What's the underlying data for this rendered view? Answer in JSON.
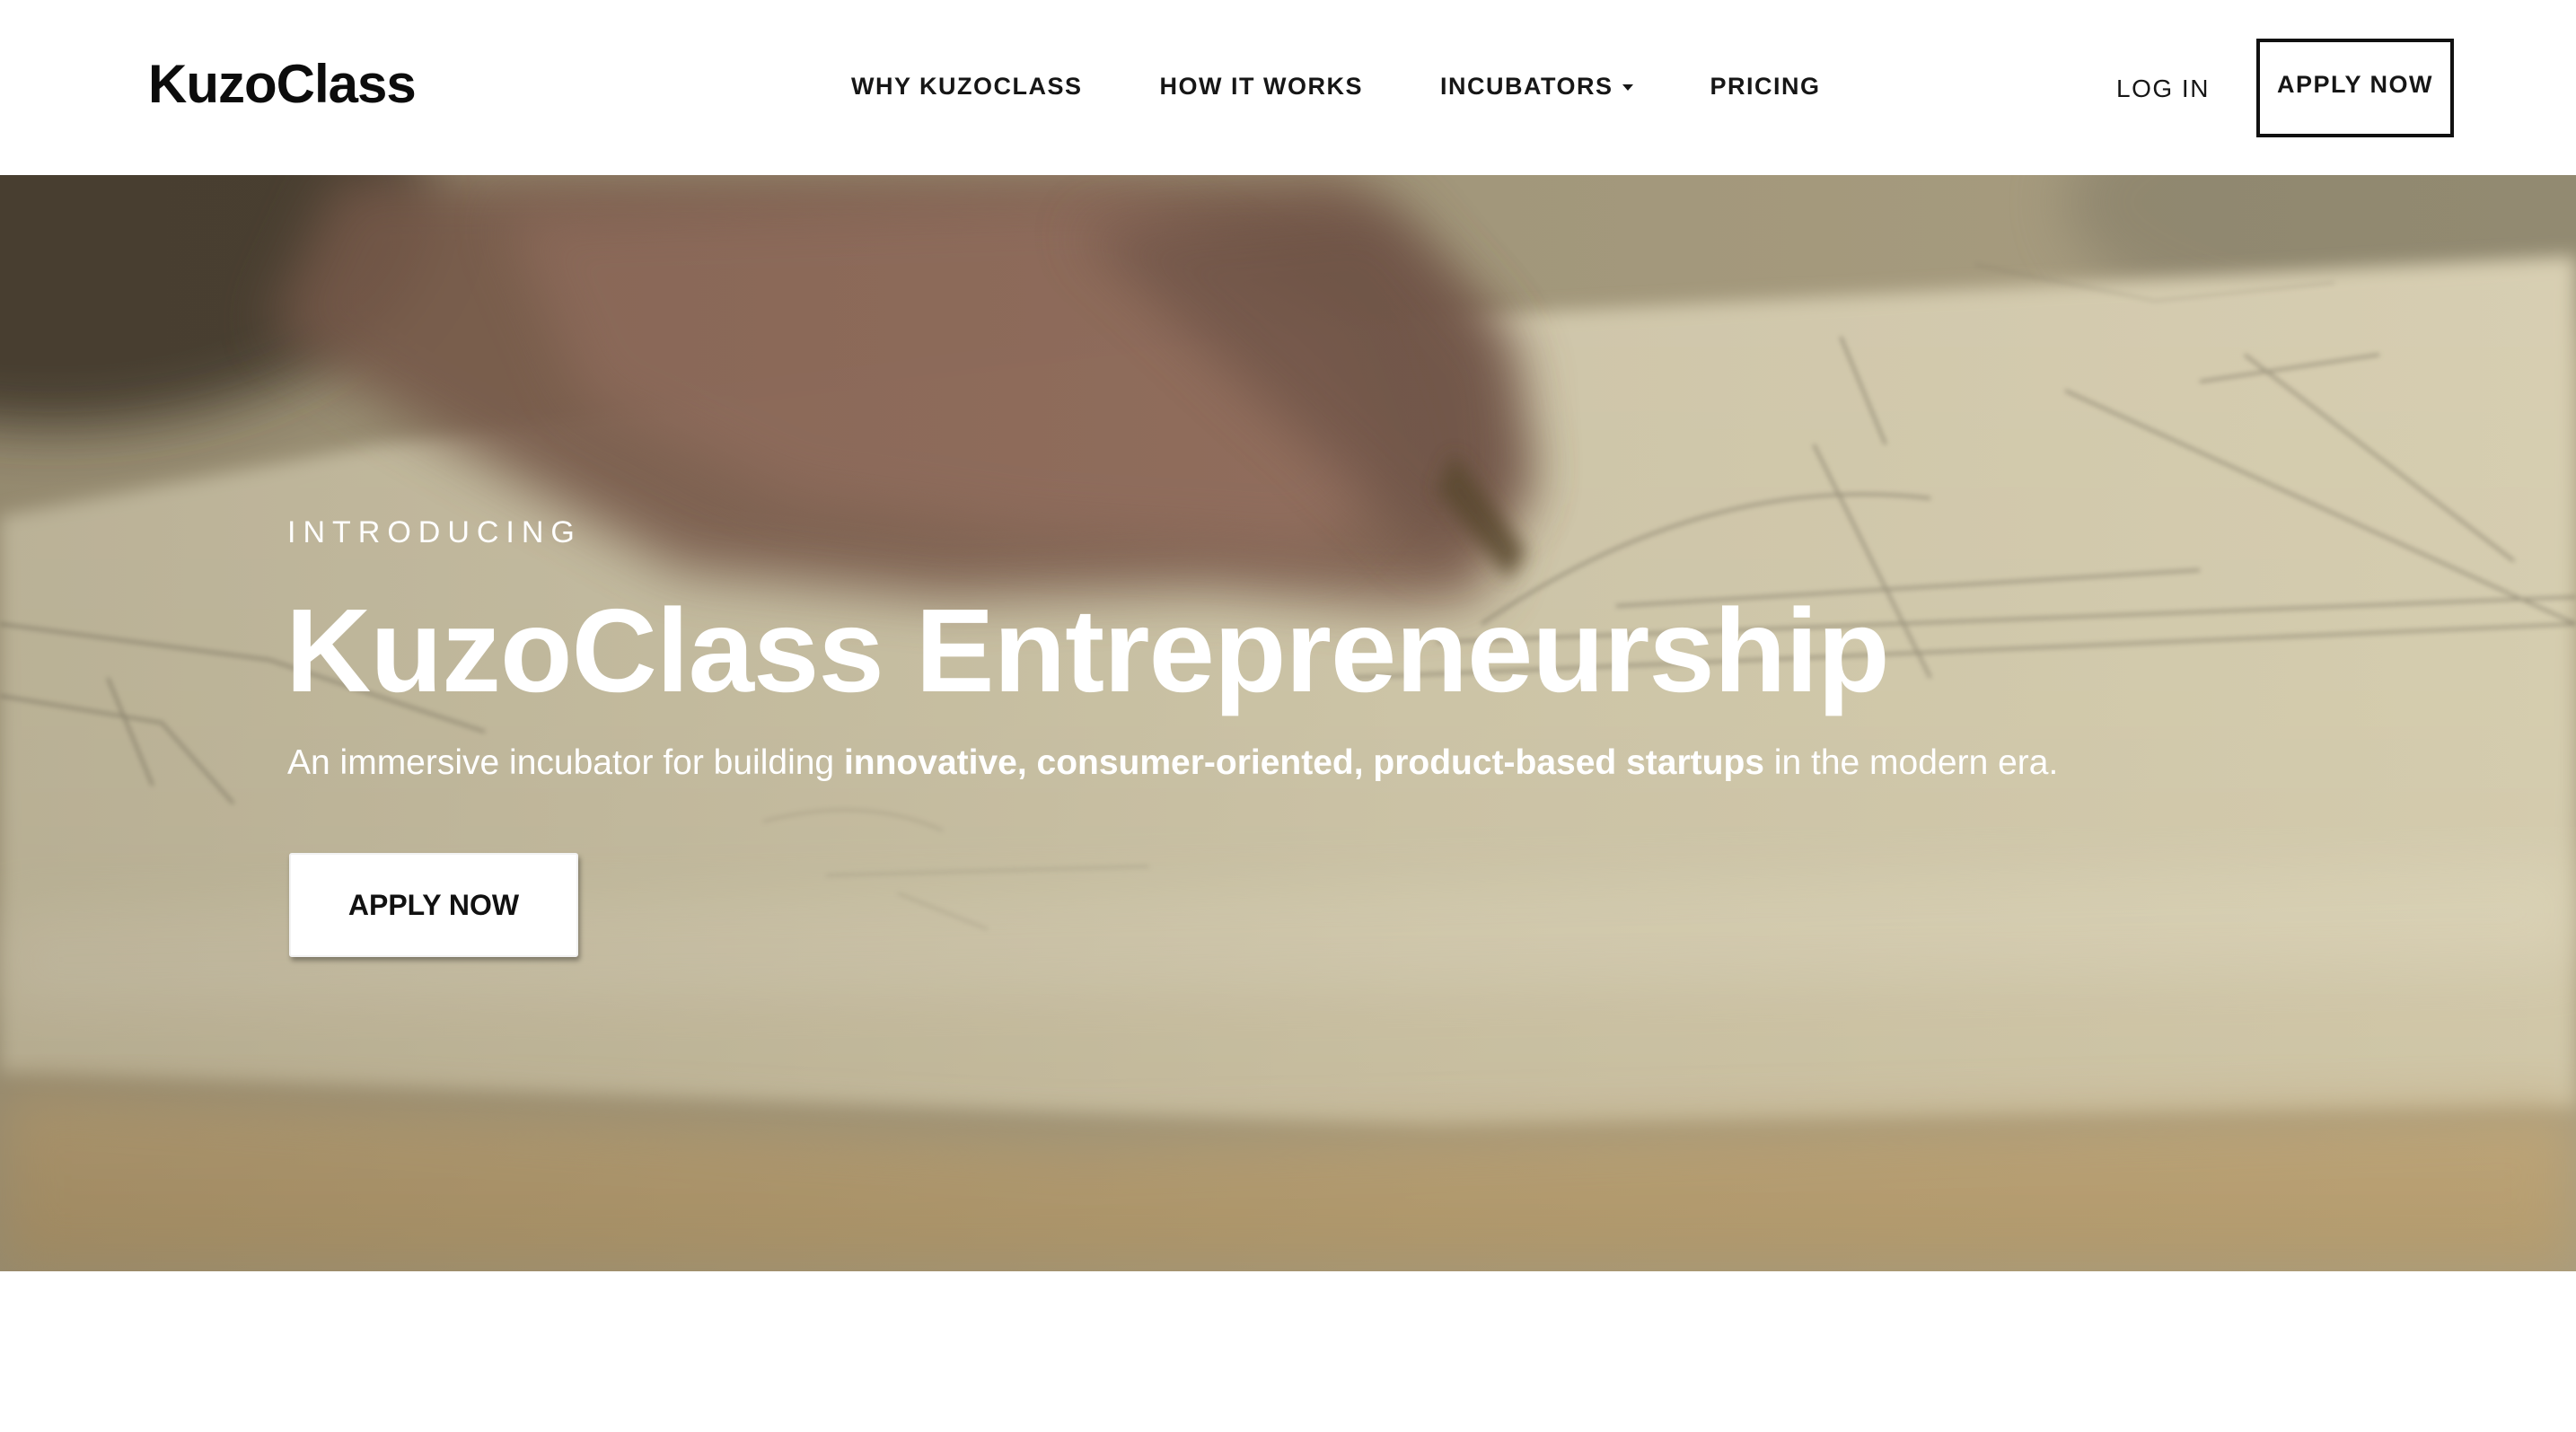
{
  "header": {
    "logo": "KuzoClass",
    "nav": [
      {
        "label": "WHY KUZOCLASS"
      },
      {
        "label": "HOW IT WORKS"
      },
      {
        "label": "INCUBATORS",
        "has_dropdown": true
      },
      {
        "label": "PRICING"
      }
    ],
    "login_label": "LOG IN",
    "apply_label": "APPLY NOW"
  },
  "hero": {
    "eyebrow": "INTRODUCING",
    "title": "KuzoClass Entrepreneurship",
    "subtitle": {
      "prefix": "An immersive incubator for building ",
      "bold": "innovative, consumer-oriented, product-based startups",
      "suffix": " in the modern era."
    },
    "cta_label": "APPLY NOW",
    "background_description_icon": "blurred-hand-sketching-on-paper-image"
  },
  "colors": {
    "header_bg": "#ffffff",
    "text_dark": "#111111",
    "hero_text": "#ffffff",
    "hero_tone": "#c9c0a3"
  }
}
